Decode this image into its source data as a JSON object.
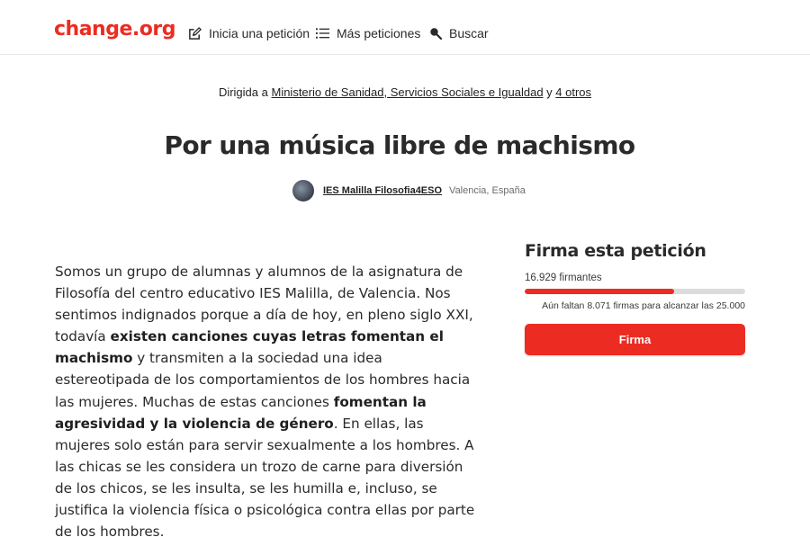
{
  "header": {
    "logo": "change.org",
    "nav": [
      {
        "label": "Inicia una petición",
        "icon": "edit-icon"
      },
      {
        "label": "Más peticiones",
        "icon": "list-icon"
      },
      {
        "label": "Buscar",
        "icon": "search-icon"
      }
    ]
  },
  "petition": {
    "directed_prefix": "Dirigida a",
    "directed_target": "Ministerio de Sanidad, Servicios Sociales e Igualdad",
    "directed_joiner": "y",
    "directed_others": "4 otros",
    "title": "Por una música libre de machismo",
    "author": "IES Malilla Filosofia4ESO",
    "location": "Valencia, España",
    "body": [
      {
        "text": "Somos un grupo de alumnas y alumnos de la asignatura de Filosofía del centro educativo IES Malilla, de Valencia. Nos sentimos indignados porque a día de hoy, en pleno siglo XXI, todavía ",
        "bold": false
      },
      {
        "text": "existen canciones cuyas letras fomentan el machismo",
        "bold": true
      },
      {
        "text": " y transmiten a la sociedad una idea estereotipada de los comportamientos de los hombres hacia las mujeres. Muchas de estas canciones ",
        "bold": false
      },
      {
        "text": "fomentan la agresividad y la violencia de género",
        "bold": true
      },
      {
        "text": ". En ellas, las mujeres solo están para servir sexualmente a los hombres. A las chicas se les considera un trozo de carne para diversión de los chicos, se les insulta, se les humilla e, incluso, se justifica la violencia física o psicológica contra ellas por parte de los hombres.",
        "bold": false
      }
    ]
  },
  "sign_box": {
    "title": "Firma esta petición",
    "signers": "16.929 firmantes",
    "progress": 0.677,
    "remaining": "Aún faltan 8.071 firmas para alcanzar las 25.000",
    "button": "Firma"
  },
  "colors": {
    "brand": "#ec2c22",
    "progress_track": "#dcdcdc"
  }
}
